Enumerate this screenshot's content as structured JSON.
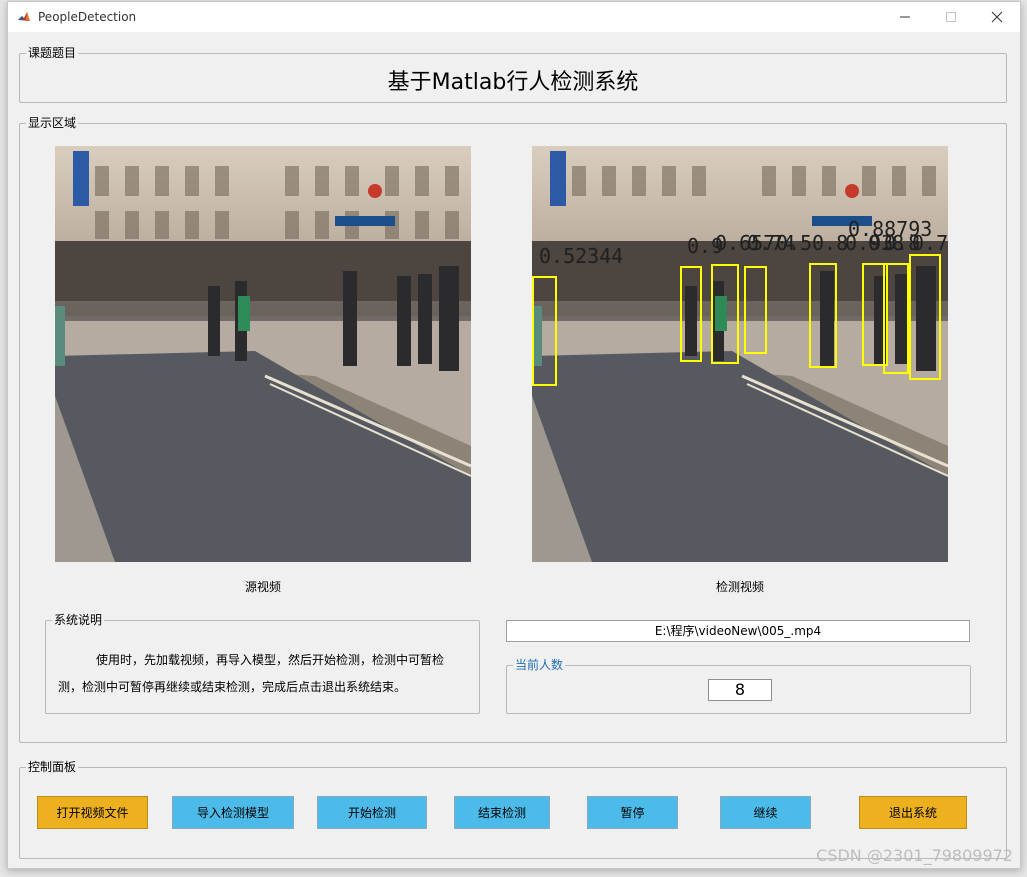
{
  "window": {
    "title": "PeopleDetection"
  },
  "topic_panel": {
    "label": "课题题目",
    "title": "基于Matlab行人检测系统"
  },
  "display_panel": {
    "label": "显示区域",
    "source_caption": "源视频",
    "detect_caption": "检测视频",
    "detections": [
      "0.52344",
      "0.9",
      "0.657",
      "0.74",
      "0.5",
      "0.8",
      "0.93",
      "0.8",
      "0.88793",
      "0.8",
      "0.72"
    ]
  },
  "description_panel": {
    "label": "系统说明",
    "text": "使用时，先加载视频，再导入模型，然后开始检测，检测中可暂检测，检测中可暂停再继续或结束检测，完成后点击退出系统结束。"
  },
  "file_path": "E:\\程序\\videoNew\\005_.mp4",
  "count_panel": {
    "label": "当前人数",
    "value": "8"
  },
  "control_panel": {
    "label": "控制面板",
    "buttons": {
      "open_video": "打开视频文件",
      "import_model": "导入检测模型",
      "start_detect": "开始检测",
      "end_detect": "结束检测",
      "pause": "暂停",
      "resume": "继续",
      "exit": "退出系统"
    }
  },
  "watermark": "CSDN @2301_79809972",
  "colors": {
    "button_blue": "#4cbbe9",
    "button_orange": "#edb120",
    "box_yellow": "#ffff00",
    "panel_label_blue": "#1f6fb3"
  }
}
